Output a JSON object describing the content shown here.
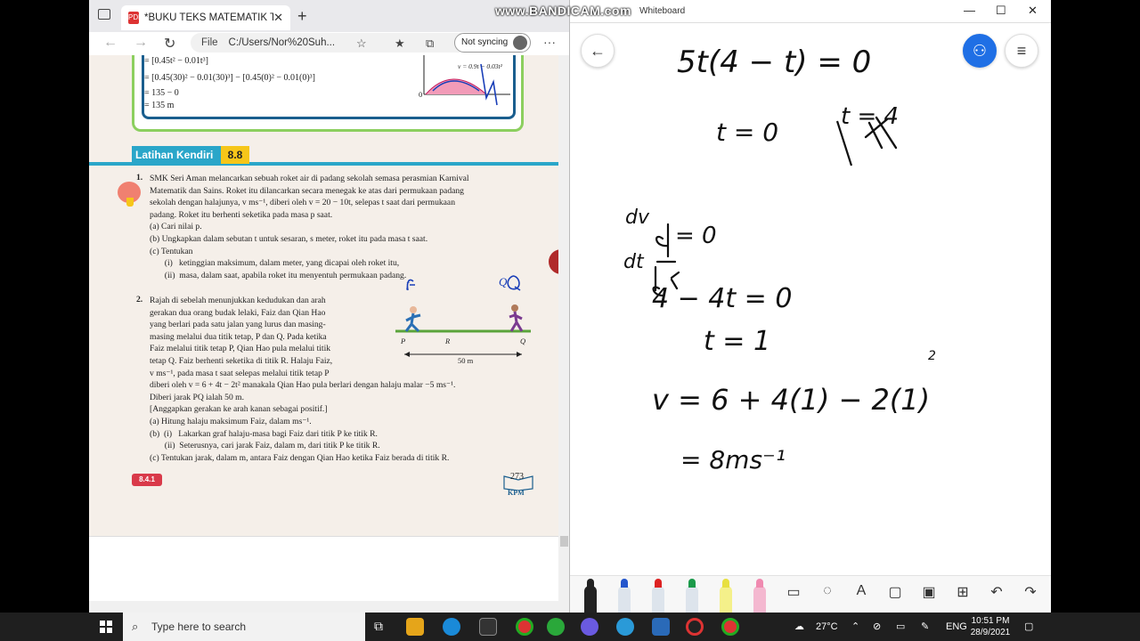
{
  "watermark": "www.BANDICAM.com",
  "edge": {
    "tab_title": "*BUKU TEKS MATEMATIK TAMBA",
    "tab_icon": "PDF",
    "address_prefix": "File",
    "address_url": "C:/Users/Nor%20Suh...",
    "sync_label": "Not syncing",
    "menu": "···"
  },
  "pdf": {
    "example_lines": [
      "= [0.45t² − 0.01t³]",
      "= [0.45(30)² − 0.01(30)³] − [0.45(0)² − 0.01(0)³]",
      "= 135 − 0",
      "= 135 m"
    ],
    "graph_label": "v = 0.9t − 0.03t²",
    "graph_zero": "0",
    "section_title": "Latihan Kendiri",
    "section_number": "8.8",
    "q1_number": "1.",
    "q1_lines": [
      "SMK Seri Aman melancarkan sebuah roket air di padang sekolah semasa perasmian Karnival",
      "Matematik dan Sains. Roket itu dilancarkan secara menegak ke atas dari permukaan padang",
      "sekolah dengan halajunya, v ms⁻¹, diberi oleh v = 20 − 10t, selepas t saat dari permukaan",
      "padang. Roket itu berhenti seketika pada masa p saat.",
      "(a)  Cari nilai p.",
      "(b)  Ungkapkan dalam sebutan t untuk sesaran, s meter, roket itu pada masa t saat.",
      "(c)  Tentukan",
      "       (i)   ketinggian maksimum, dalam meter, yang dicapai oleh roket itu,",
      "       (ii)  masa, dalam saat, apabila roket itu menyentuh permukaan padang."
    ],
    "q2_number": "2.",
    "q2_lines": [
      "Rajah di sebelah menunjukkan kedudukan dan arah",
      "gerakan dua orang budak lelaki, Faiz dan Qian Hao",
      "yang berlari pada satu jalan yang lurus dan masing-",
      "masing melalui dua titik tetap, P dan Q. Pada ketika",
      "Faiz melalui titik tetap P, Qian Hao pula melalui titik",
      "tetap Q. Faiz berhenti seketika di titik R. Halaju Faiz,",
      "v ms⁻¹, pada masa t saat selepas melalui titik tetap P",
      "diberi oleh v = 6 + 4t − 2t² manakala Qian Hao pula berlari dengan halaju malar −5 ms⁻¹.",
      "Diberi jarak PQ ialah 50 m.",
      "[Anggapkan gerakan ke arah kanan sebagai positif.]",
      "(a)  Hitung halaju maksimum Faiz, dalam ms⁻¹.",
      "(b)  (i)   Lakarkan graf halaju-masa bagi Faiz dari titik P ke titik R.",
      "       (ii)  Seterusnya, cari jarak Faiz, dalam m, dari titik P ke titik R.",
      "(c)  Tentukan jarak, dalam m, antara Faiz dengan Qian Hao ketika Faiz berada di titik R."
    ],
    "diagram": {
      "p": "P",
      "r": "R",
      "q": "Q",
      "distance": "50 m",
      "hand_f": "f",
      "hand_q": "Q"
    },
    "tag": "8.4.1",
    "page_number": "273",
    "kpm": "KPM"
  },
  "whiteboard": {
    "window_title": "Whiteboard",
    "handwriting": [
      "5t(4 − t) = 0",
      "t = 0",
      "t = 4",
      "dv",
      "dt",
      "= 0",
      "4 − 4t = 0",
      "t = 1",
      "v = 6 + 4(1) − 2(1)",
      "2",
      "= 8ms⁻¹"
    ]
  },
  "taskbar": {
    "search_placeholder": "Type here to search",
    "weather": "27°C",
    "lang": "ENG",
    "time": "10:51 PM",
    "date": "28/9/2021"
  }
}
